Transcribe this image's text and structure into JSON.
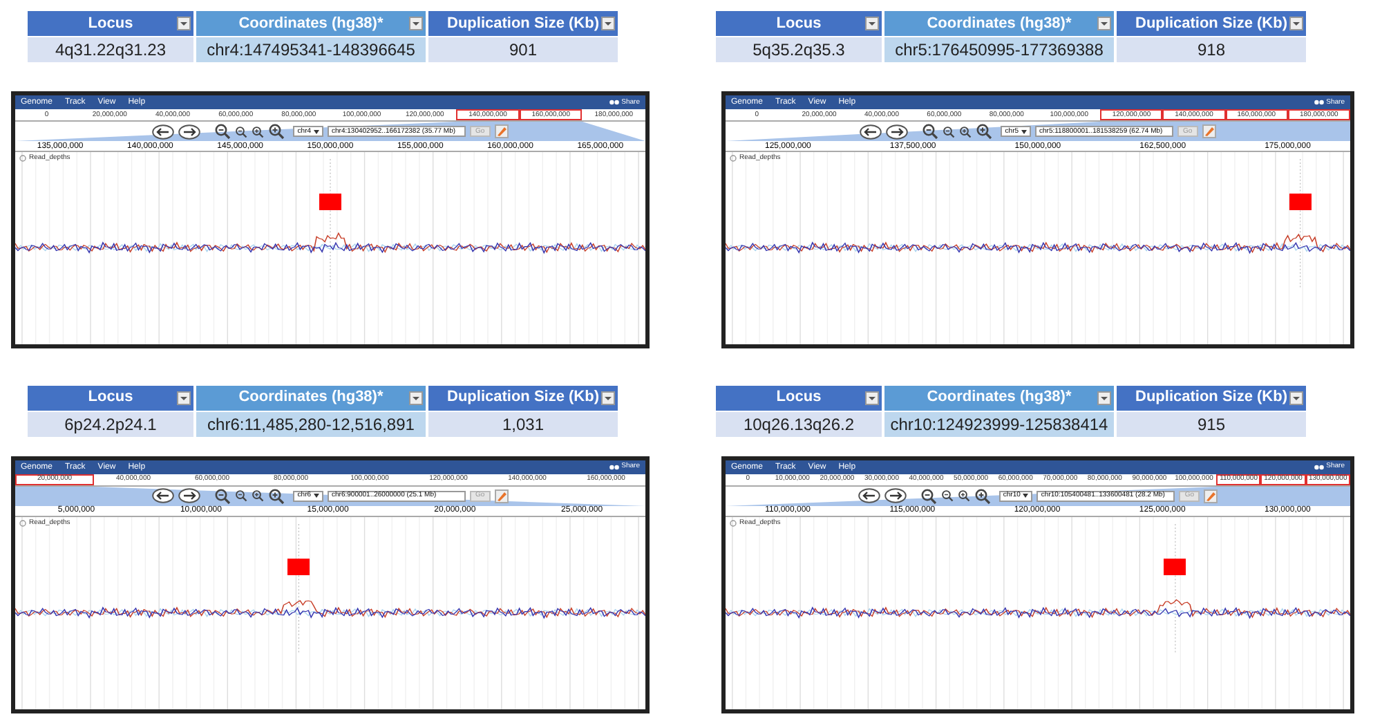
{
  "panels": [
    {
      "table": {
        "columns": [
          "Locus",
          "Coordinates (hg38)*",
          "Duplication Size (Kb)"
        ],
        "row": [
          "4q31.22q31.23",
          "chr4:147495341-148396645",
          "901"
        ]
      },
      "browser": {
        "menu": [
          "Genome",
          "Track",
          "View",
          "Help"
        ],
        "share": "Share",
        "overview_ruler": [
          {
            "label": "0",
            "highlighted": false
          },
          {
            "label": "20,000,000",
            "highlighted": false
          },
          {
            "label": "40,000,000",
            "highlighted": false
          },
          {
            "label": "60,000,000",
            "highlighted": false
          },
          {
            "label": "80,000,000",
            "highlighted": false
          },
          {
            "label": "100,000,000",
            "highlighted": false
          },
          {
            "label": "120,000,000",
            "highlighted": false
          },
          {
            "label": "140,000,000",
            "highlighted": true
          },
          {
            "label": "160,000,000",
            "highlighted": true
          },
          {
            "label": "180,000,000",
            "highlighted": false
          }
        ],
        "chromosome": "chr4",
        "location": "chr4:130402952..166172382 (35.77 Mb)",
        "go": "Go",
        "detail_ruler": [
          "135,000,000",
          "140,000,000",
          "145,000,000",
          "150,000,000",
          "155,000,000",
          "160,000,000",
          "165,000,000"
        ],
        "track": "Read_depths"
      }
    },
    {
      "table": {
        "columns": [
          "Locus",
          "Coordinates (hg38)*",
          "Duplication Size (Kb)"
        ],
        "row": [
          "5q35.2q35.3",
          "chr5:176450995-177369388",
          "918"
        ]
      },
      "browser": {
        "menu": [
          "Genome",
          "Track",
          "View",
          "Help"
        ],
        "share": "Share",
        "overview_ruler": [
          {
            "label": "0",
            "highlighted": false
          },
          {
            "label": "20,000,000",
            "highlighted": false
          },
          {
            "label": "40,000,000",
            "highlighted": false
          },
          {
            "label": "60,000,000",
            "highlighted": false
          },
          {
            "label": "80,000,000",
            "highlighted": false
          },
          {
            "label": "100,000,000",
            "highlighted": false
          },
          {
            "label": "120,000,000",
            "highlighted": true
          },
          {
            "label": "140,000,000",
            "highlighted": true
          },
          {
            "label": "160,000,000",
            "highlighted": true
          },
          {
            "label": "180,000,000",
            "highlighted": true
          }
        ],
        "chromosome": "chr5",
        "location": "chr5:118800001..181538259 (62.74 Mb)",
        "go": "Go",
        "detail_ruler": [
          "125,000,000",
          "137,500,000",
          "150,000,000",
          "162,500,000",
          "175,000,000"
        ],
        "track": "Read_depths"
      }
    },
    {
      "table": {
        "columns": [
          "Locus",
          "Coordinates (hg38)*",
          "Duplication Size (Kb)"
        ],
        "row": [
          "6p24.2p24.1",
          "chr6:11,485,280-12,516,891",
          "1,031"
        ]
      },
      "browser": {
        "menu": [
          "Genome",
          "Track",
          "View",
          "Help"
        ],
        "share": "Share",
        "overview_ruler": [
          {
            "label": "20,000,000",
            "highlighted": true
          },
          {
            "label": "40,000,000",
            "highlighted": false
          },
          {
            "label": "60,000,000",
            "highlighted": false
          },
          {
            "label": "80,000,000",
            "highlighted": false
          },
          {
            "label": "100,000,000",
            "highlighted": false
          },
          {
            "label": "120,000,000",
            "highlighted": false
          },
          {
            "label": "140,000,000",
            "highlighted": false
          },
          {
            "label": "160,000,000",
            "highlighted": false
          }
        ],
        "chromosome": "chr6",
        "location": "chr6:900001..26000000 (25.1 Mb)",
        "go": "Go",
        "detail_ruler": [
          "5,000,000",
          "10,000,000",
          "15,000,000",
          "20,000,000",
          "25,000,000"
        ],
        "track": "Read_depths"
      }
    },
    {
      "table": {
        "columns": [
          "Locus",
          "Coordinates (hg38)*",
          "Duplication Size (Kb)"
        ],
        "row": [
          "10q26.13q26.2",
          "chr10:124923999-125838414",
          "915"
        ]
      },
      "browser": {
        "menu": [
          "Genome",
          "Track",
          "View",
          "Help"
        ],
        "share": "Share",
        "overview_ruler": [
          {
            "label": "0",
            "highlighted": false
          },
          {
            "label": "10,000,000",
            "highlighted": false
          },
          {
            "label": "20,000,000",
            "highlighted": false
          },
          {
            "label": "30,000,000",
            "highlighted": false
          },
          {
            "label": "40,000,000",
            "highlighted": false
          },
          {
            "label": "50,000,000",
            "highlighted": false
          },
          {
            "label": "60,000,000",
            "highlighted": false
          },
          {
            "label": "70,000,000",
            "highlighted": false
          },
          {
            "label": "80,000,000",
            "highlighted": false
          },
          {
            "label": "90,000,000",
            "highlighted": false
          },
          {
            "label": "100,000,000",
            "highlighted": false
          },
          {
            "label": "110,000,000",
            "highlighted": true
          },
          {
            "label": "120,000,000",
            "highlighted": true
          },
          {
            "label": "130,000,000",
            "highlighted": true
          }
        ],
        "chromosome": "chr10",
        "location": "chr10:105400481..133600481 (28.2 Mb)",
        "go": "Go",
        "detail_ruler": [
          "110,000,000",
          "115,000,000",
          "120,000,000",
          "125,000,000",
          "130,000,000"
        ],
        "track": "Read_depths"
      }
    }
  ]
}
